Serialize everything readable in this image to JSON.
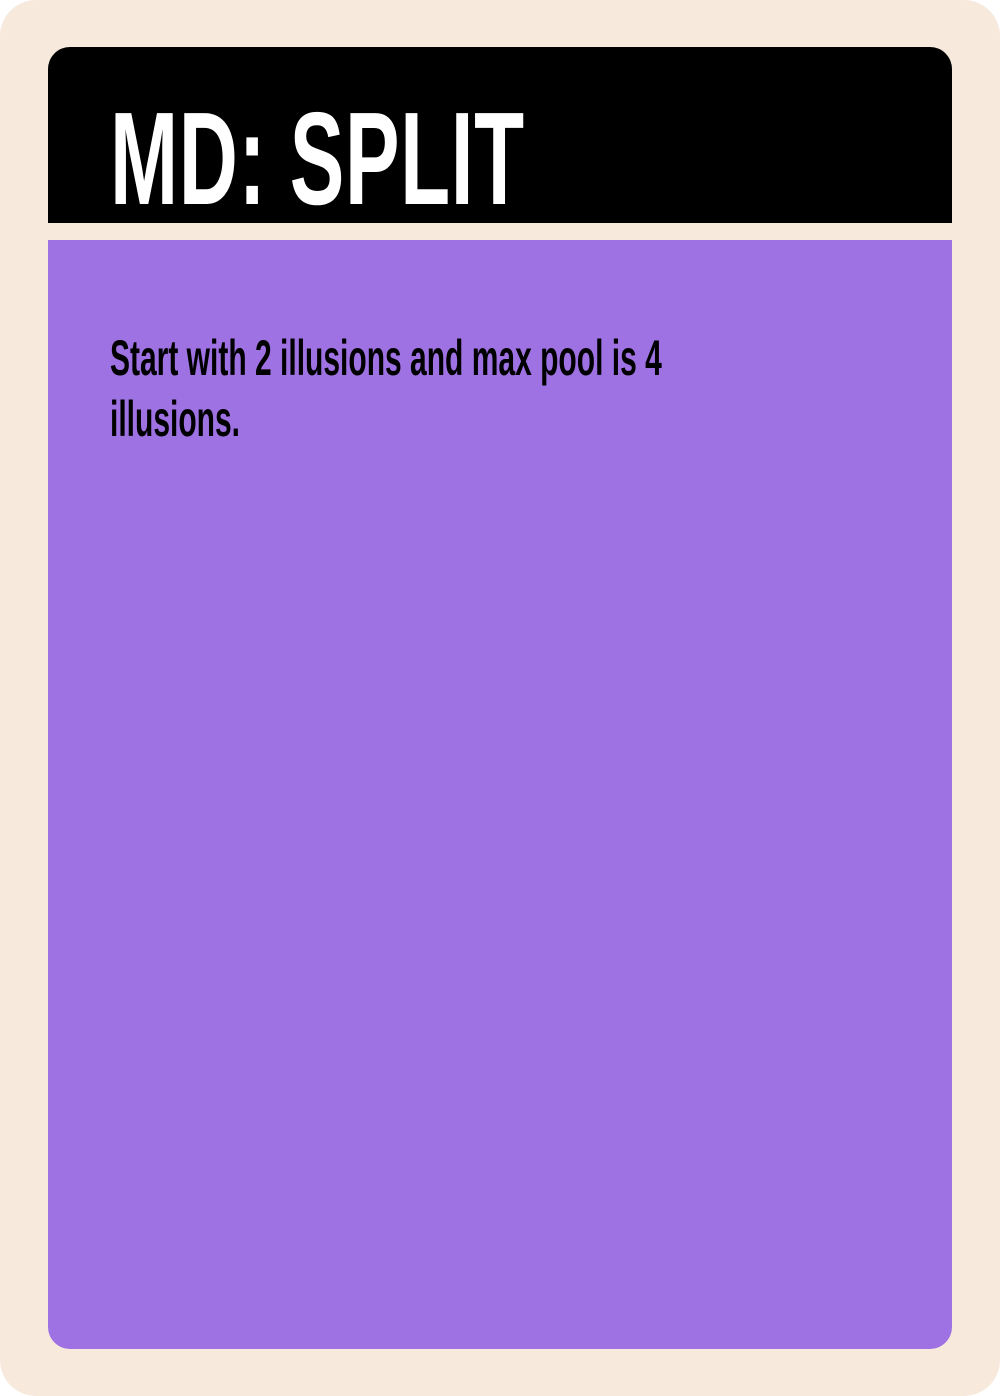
{
  "card": {
    "title": "MD: SPLIT",
    "rule_text": "Start with 2 illusions and max pool is 4 illusions.",
    "colors": {
      "frame": "#f7e9dc",
      "title_bar": "#000000",
      "title_text": "#ffffff",
      "body_panel": "#9f72e3",
      "body_text": "#000000"
    }
  }
}
